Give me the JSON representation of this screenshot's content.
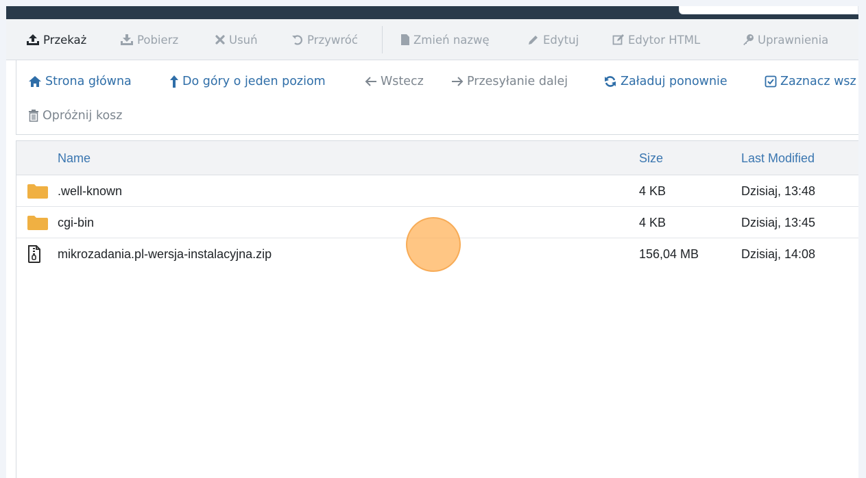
{
  "toolbar": {
    "items": [
      {
        "label": "Przekaż",
        "icon": "upload-icon",
        "active": true
      },
      {
        "label": "Pobierz",
        "icon": "download-icon",
        "active": false
      },
      {
        "label": "Usuń",
        "icon": "delete-x-icon",
        "active": false
      },
      {
        "label": "Przywróć",
        "icon": "restore-icon",
        "active": false
      },
      {
        "label": "Zmień nazwę",
        "icon": "file-icon",
        "active": false
      },
      {
        "label": "Edytuj",
        "icon": "pencil-icon",
        "active": false
      },
      {
        "label": "Edytor HTML",
        "icon": "edit-box-icon",
        "active": false
      },
      {
        "label": "Uprawnienia",
        "icon": "key-icon",
        "active": false
      }
    ]
  },
  "nav": {
    "home": "Strona główna",
    "up_one": "Do góry o jeden poziom",
    "back": "Wstecz",
    "forward": "Przesyłanie dalej",
    "reload": "Załaduj ponownie",
    "select_all": "Zaznacz wsz",
    "empty_trash": "Opróżnij kosz"
  },
  "table": {
    "headers": {
      "name": "Name",
      "size": "Size",
      "modified": "Last Modified"
    },
    "rows": [
      {
        "type": "folder",
        "name": ".well-known",
        "size": "4 KB",
        "modified": "Dzisiaj, 13:48"
      },
      {
        "type": "folder",
        "name": "cgi-bin",
        "size": "4 KB",
        "modified": "Dzisiaj, 13:45"
      },
      {
        "type": "zip",
        "name": "mikrozadania.pl-wersja-instalacyjna.zip",
        "size": "156,04 MB",
        "modified": "Dzisiaj, 14:08"
      }
    ]
  },
  "colors": {
    "topbar": "#293a4a",
    "link_blue": "#2f6ea8",
    "header_blue": "#3a76b0",
    "folder": "#f0b042",
    "cursor_highlight": "#ffb054"
  }
}
